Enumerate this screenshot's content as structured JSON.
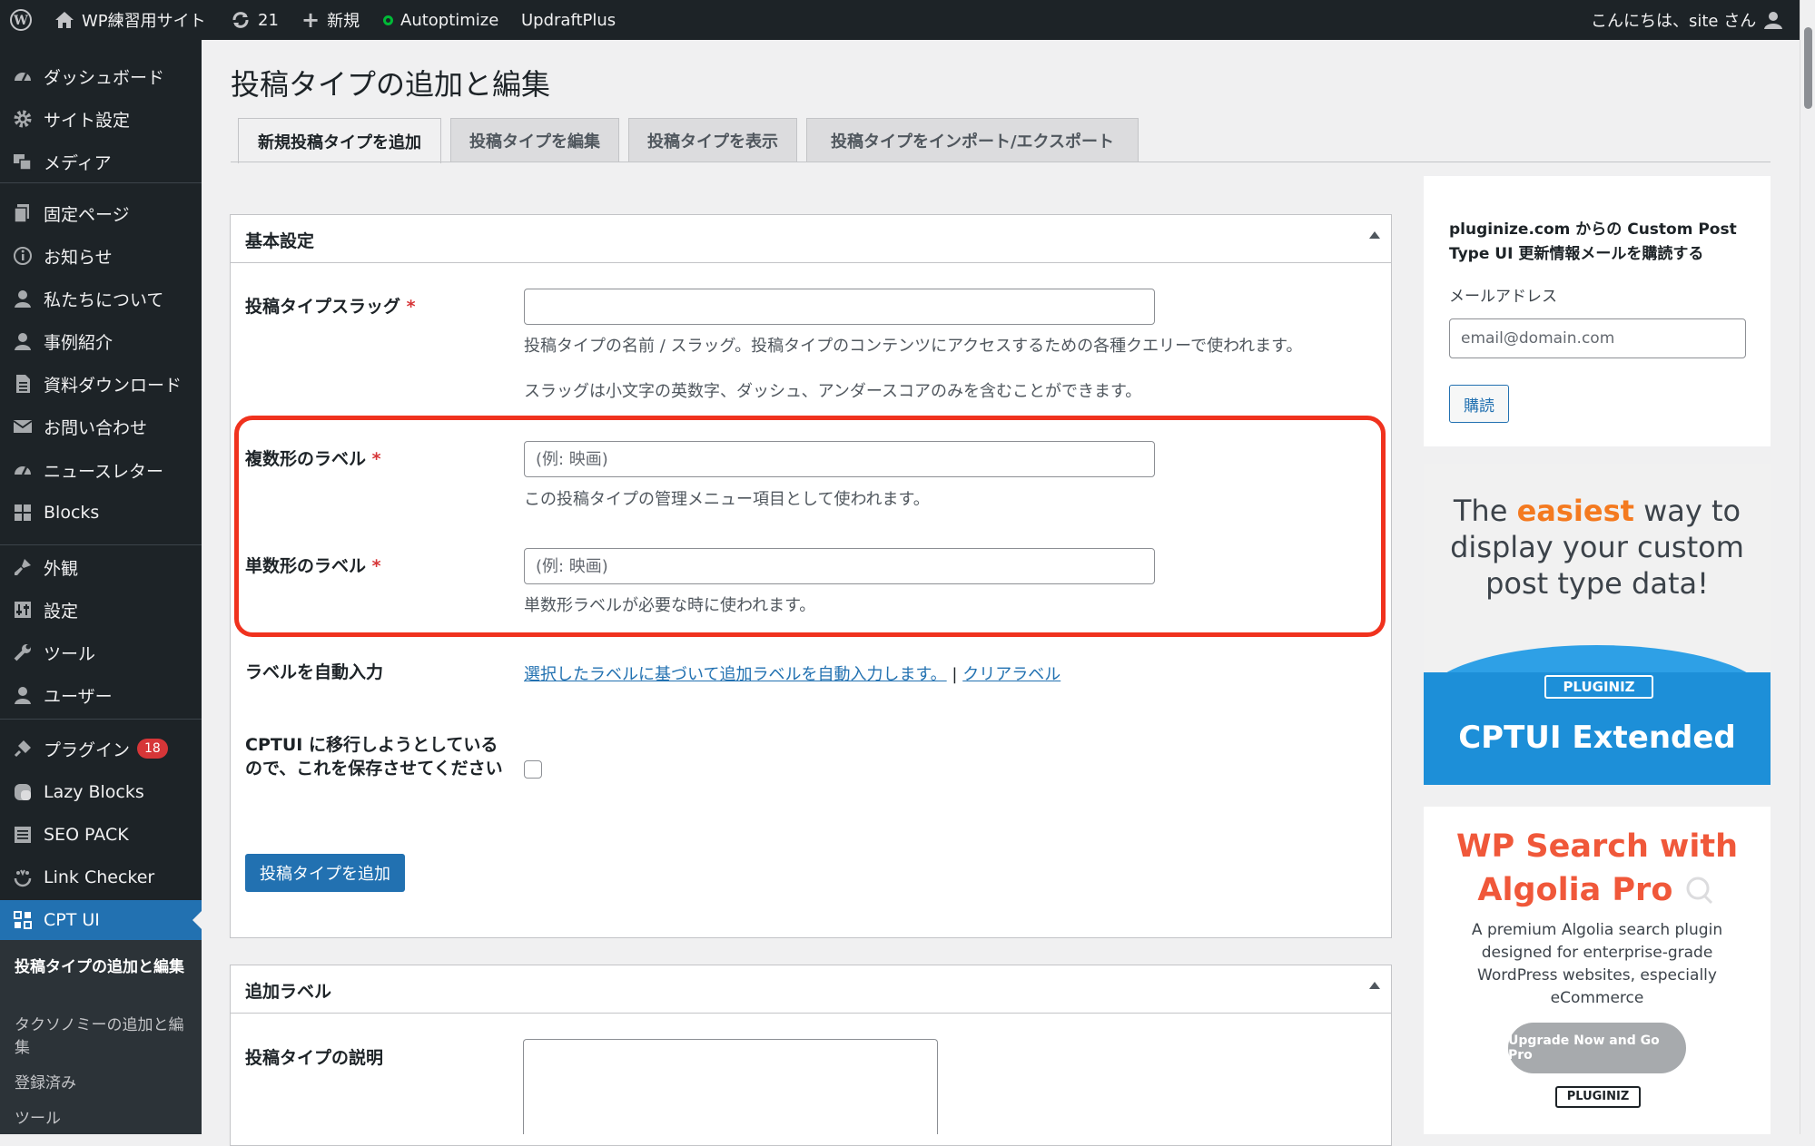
{
  "adminbar": {
    "site_name": "WP練習用サイト",
    "updates_count": "21",
    "new_label": "新規",
    "autoptimize": "Autoptimize",
    "updraftplus": "UpdraftPlus",
    "greeting": "こんにちは、site さん"
  },
  "sidebar": {
    "items": [
      {
        "label": "ダッシュボード",
        "icon": "dashboard-icon"
      },
      {
        "label": "サイト設定",
        "icon": "gear-icon"
      },
      {
        "label": "メディア",
        "icon": "media-icon"
      },
      {
        "label": "固定ページ",
        "icon": "pages-icon"
      },
      {
        "label": "お知らせ",
        "icon": "info-icon"
      },
      {
        "label": "私たちについて",
        "icon": "user-icon"
      },
      {
        "label": "事例紹介",
        "icon": "user-icon"
      },
      {
        "label": "資料ダウンロード",
        "icon": "document-icon"
      },
      {
        "label": "お問い合わせ",
        "icon": "mail-icon"
      },
      {
        "label": "ニュースレター",
        "icon": "dashboard-icon"
      },
      {
        "label": "Blocks",
        "icon": "blocks-icon"
      },
      {
        "label": "外観",
        "icon": "brush-icon"
      },
      {
        "label": "設定",
        "icon": "settings-icon"
      },
      {
        "label": "ツール",
        "icon": "wrench-icon"
      },
      {
        "label": "ユーザー",
        "icon": "user-icon"
      },
      {
        "label": "プラグイン",
        "icon": "plugin-icon",
        "badge": "18"
      },
      {
        "label": "Lazy Blocks",
        "icon": "lazy-blocks-icon"
      },
      {
        "label": "SEO PACK",
        "icon": "list-icon"
      },
      {
        "label": "Link Checker",
        "icon": "link-checker-icon"
      },
      {
        "label": "CPT UI",
        "icon": "cptui-icon"
      }
    ],
    "submenu": [
      "投稿タイプの追加と編集",
      "タクソノミーの追加と編集",
      "登録済み",
      "ツール"
    ]
  },
  "main": {
    "page_title": "投稿タイプの追加と編集",
    "tabs": [
      "新規投稿タイプを追加",
      "投稿タイプを編集",
      "投稿タイプを表示",
      "投稿タイプをインポート/エクスポート"
    ],
    "basic_settings": {
      "title": "基本設定",
      "slug_label": "投稿タイプスラッグ",
      "required_mark": "*",
      "slug_value": "",
      "slug_desc1": "投稿タイプの名前 / スラッグ。投稿タイプのコンテンツにアクセスするための各種クエリーで使われます。",
      "slug_desc2": "スラッグは小文字の英数字、ダッシュ、アンダースコアのみを含むことができます。",
      "plural_label": "複数形のラベル",
      "plural_placeholder": "(例: 映画)",
      "plural_desc": "この投稿タイプの管理メニュー項目として使われます。",
      "singular_label": "単数形のラベル",
      "singular_placeholder": "(例: 映画)",
      "singular_desc": "単数形ラベルが必要な時に使われます。",
      "autofill_label": "ラベルを自動入力",
      "autofill_link": "選択したラベルに基づいて追加ラベルを自動入力します。",
      "separator": "|",
      "clear_link": "クリアラベル",
      "migrate_label": "CPTUI に移行しようとしているので、これを保存させてください",
      "submit": "投稿タイプを追加"
    },
    "additional_labels": {
      "title": "追加ラベル",
      "description_label": "投稿タイプの説明"
    }
  },
  "side": {
    "newsletter": {
      "heading": "pluginize.com からの Custom Post Type UI 更新情報メールを購読する",
      "email_label": "メールアドレス",
      "email_placeholder": "email@domain.com",
      "subscribe": "購読"
    },
    "ad1": {
      "line1_pre": "The ",
      "line1_em": "easiest",
      "line1_post": " way to",
      "line2": "display your custom",
      "line3": "post type data!",
      "brand": "PLUGINIZ",
      "product": "CPTUI Extended"
    },
    "ad2": {
      "title1": "WP Search with",
      "title2": "Algolia Pro",
      "desc": "A premium Algolia search plugin designed for enterprise-grade WordPress websites, especially eCommerce",
      "cta": "Upgrade Now and Go Pro",
      "brand": "PLUGINIZ"
    }
  },
  "colors": {
    "adminbar": "#1d2327",
    "accent": "#2271b1",
    "highlight": "#f0321e",
    "ad_orange": "#f47a20",
    "ad_red": "#f0583a"
  }
}
